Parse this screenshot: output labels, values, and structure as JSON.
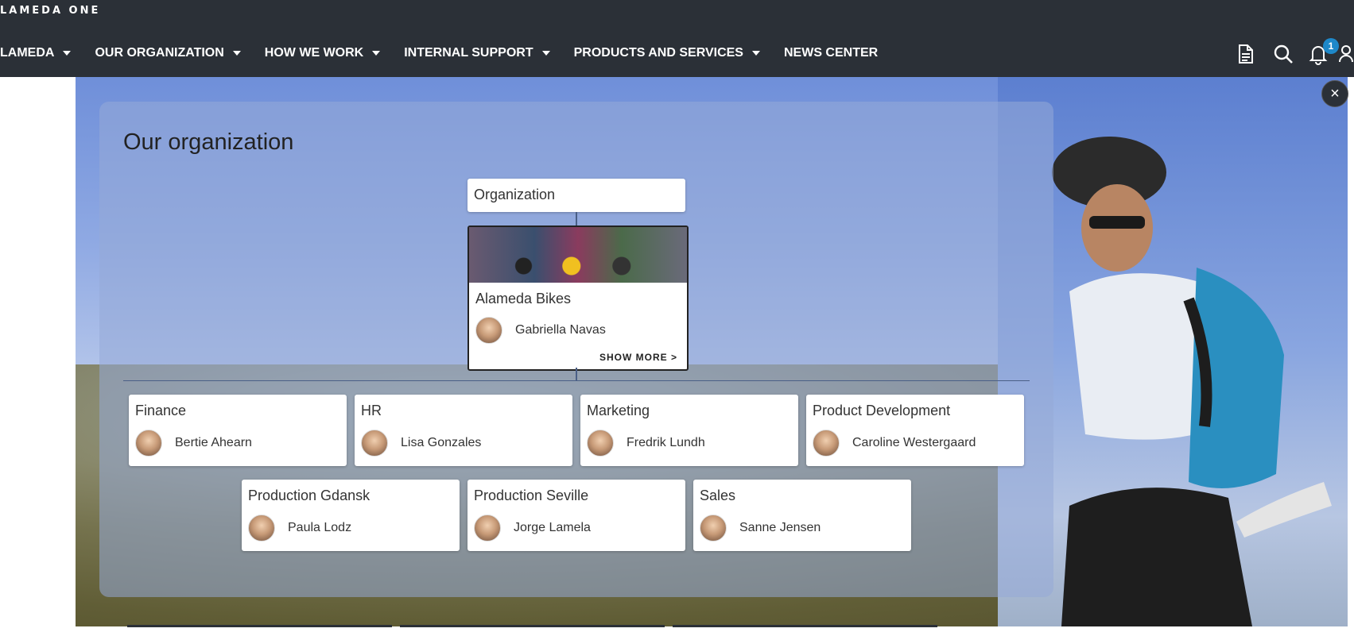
{
  "brand": {
    "name": "LAMEDA ONE"
  },
  "nav": {
    "items": [
      {
        "label": "LAMEDA",
        "dropdown": true
      },
      {
        "label": "OUR ORGANIZATION",
        "dropdown": true
      },
      {
        "label": "HOW WE WORK",
        "dropdown": true
      },
      {
        "label": "INTERNAL SUPPORT",
        "dropdown": true
      },
      {
        "label": "PRODUCTS AND SERVICES",
        "dropdown": true
      },
      {
        "label": "NEWS CENTER",
        "dropdown": false
      }
    ]
  },
  "tools": {
    "icons": [
      "document-icon",
      "search-icon",
      "bell-icon",
      "people-icon"
    ],
    "notification_count": "1"
  },
  "overlay": {
    "title": "Our organization",
    "close_label": "×",
    "root": {
      "label": "Organization"
    },
    "main_unit": {
      "name": "Alameda Bikes",
      "person": "Gabriella Navas",
      "show_more": "SHOW MORE >"
    },
    "units_row1": [
      {
        "name": "Finance",
        "person": "Bertie Ahearn"
      },
      {
        "name": "HR",
        "person": "Lisa Gonzales"
      },
      {
        "name": "Marketing",
        "person": "Fredrik Lundh"
      },
      {
        "name": "Product Development",
        "person": "Caroline Westergaard"
      }
    ],
    "units_row2": [
      {
        "name": "Production Gdansk",
        "person": "Paula Lodz"
      },
      {
        "name": "Production Seville",
        "person": "Jorge Lamela"
      },
      {
        "name": "Sales",
        "person": "Sanne Jensen"
      }
    ]
  },
  "colors": {
    "topbar": "#2b3037",
    "accent_badge": "#1e88c9",
    "connector": "#4a5f86"
  }
}
